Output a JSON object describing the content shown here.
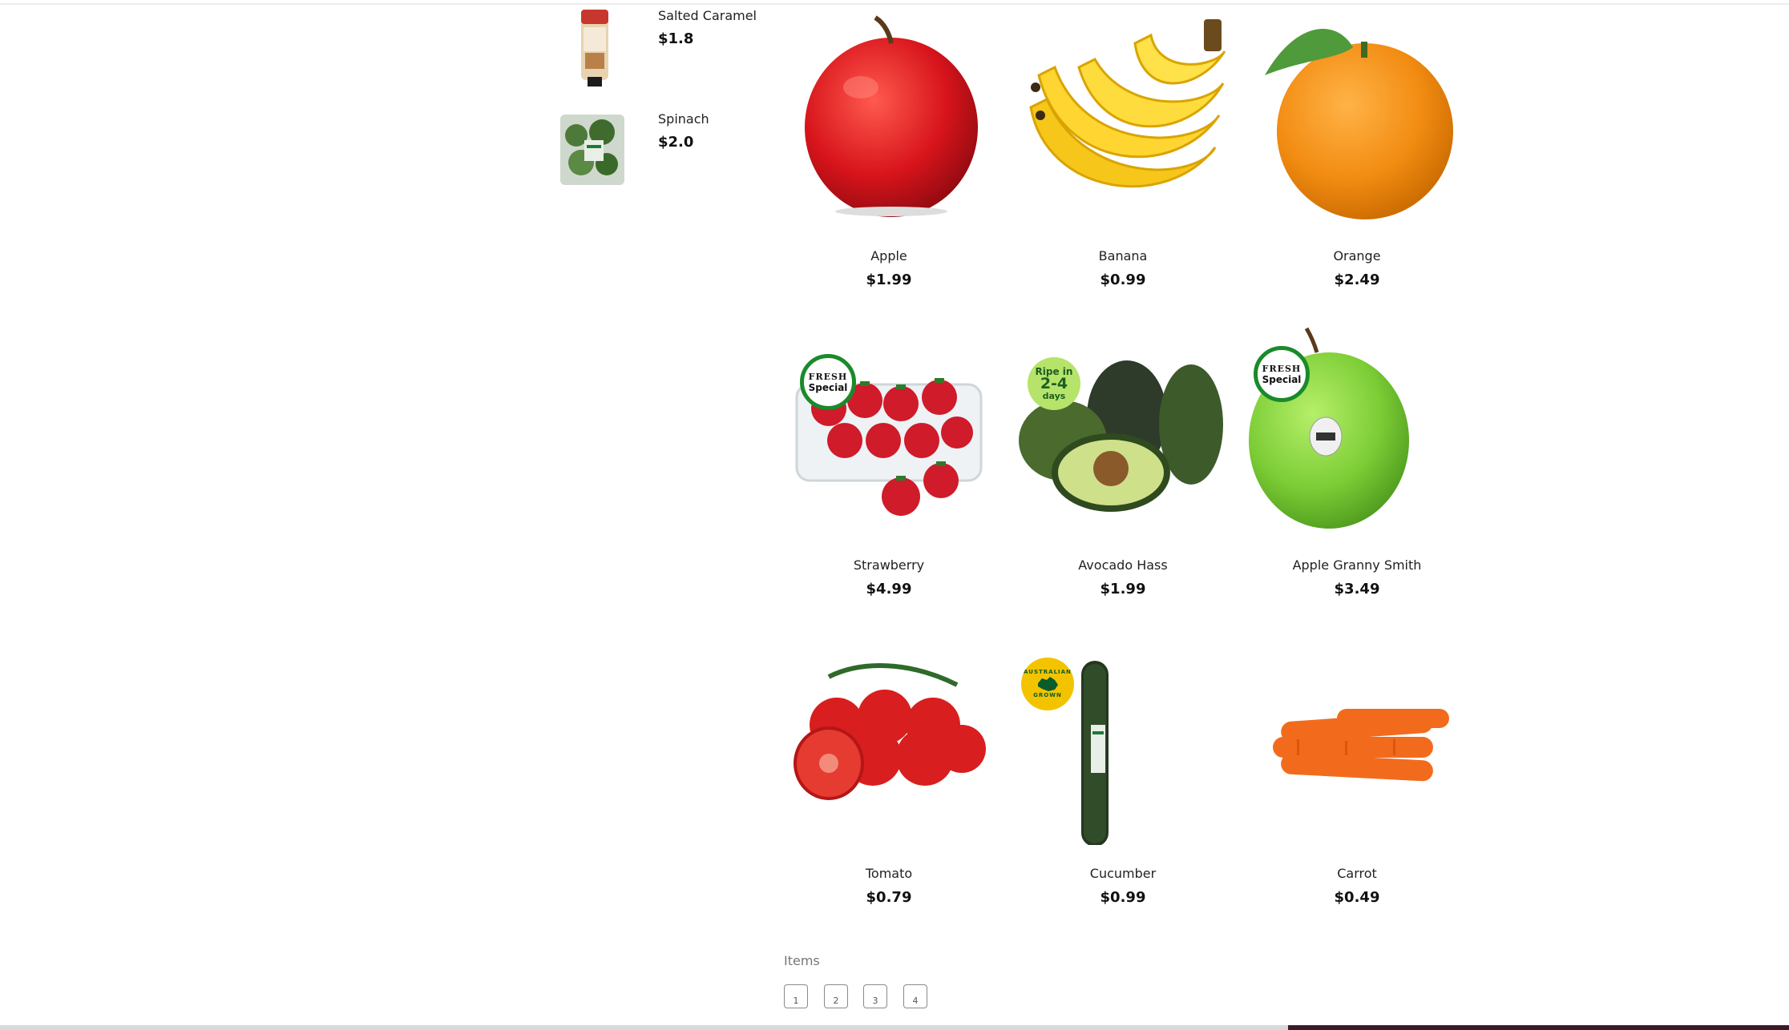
{
  "sidebar": {
    "items": [
      {
        "name": "Salted Caramel",
        "price": "$1.8",
        "icon": "salted-caramel-image"
      },
      {
        "name": "Spinach",
        "price": "$2.0",
        "icon": "spinach-image"
      }
    ]
  },
  "products": [
    {
      "name": "Apple",
      "price": "$1.99"
    },
    {
      "name": "Banana",
      "price": "$0.99"
    },
    {
      "name": "Orange",
      "price": "$2.49"
    },
    {
      "name": "Strawberry",
      "price": "$4.99",
      "badge": {
        "line1": "FRESH",
        "line2": "Special"
      }
    },
    {
      "name": "Avocado Hass",
      "price": "$1.99",
      "badge": {
        "line1": "Ripe in",
        "line2": "2-4",
        "line3": "days"
      }
    },
    {
      "name": "Apple Granny Smith",
      "price": "$3.49",
      "badge": {
        "line1": "FRESH",
        "line2": "Special"
      }
    },
    {
      "name": "Tomato",
      "price": "$0.79"
    },
    {
      "name": "Cucumber",
      "price": "$0.99",
      "badge": {
        "line1": "AUSTRALIAN",
        "line2": "GROWN"
      }
    },
    {
      "name": "Carrot",
      "price": "$0.49"
    }
  ],
  "pagination": {
    "label": "Items",
    "pages": [
      "1",
      "2",
      "3",
      "4"
    ]
  },
  "colors": {
    "fresh_badge_green": "#1a8a2a",
    "ripe_badge": "#b6e36a",
    "australian_badge": "#f3c300"
  }
}
